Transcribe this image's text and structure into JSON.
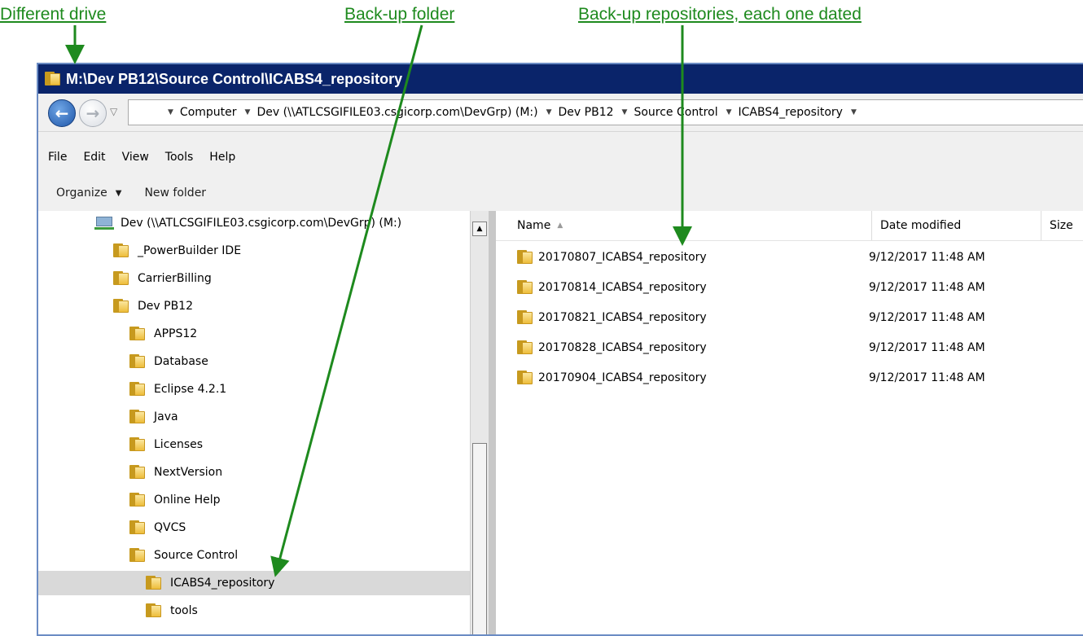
{
  "annotations": {
    "drive": "Different drive",
    "folder": "Back-up folder",
    "repos": "Back-up repositories, each one dated"
  },
  "window": {
    "title": "M:\\Dev PB12\\Source Control\\ICABS4_repository"
  },
  "address": {
    "crumbs": [
      "Computer",
      "Dev (\\\\ATLCSGIFILE03.csgicorp.com\\DevGrp) (M:)",
      "Dev PB12",
      "Source Control",
      "ICABS4_repository"
    ]
  },
  "menu": [
    "File",
    "Edit",
    "View",
    "Tools",
    "Help"
  ],
  "toolbar": {
    "organize": "Organize",
    "new_folder": "New folder"
  },
  "tree": {
    "items": [
      {
        "label": "Dev (\\\\ATLCSGIFILE03.csgicorp.com\\DevGrp) (M:)",
        "icon": "network-drive-icon",
        "selected": false
      },
      {
        "label": "_PowerBuilder IDE",
        "icon": "folder-icon",
        "selected": false
      },
      {
        "label": "CarrierBilling",
        "icon": "folder-icon",
        "selected": false
      },
      {
        "label": "Dev PB12",
        "icon": "folder-icon",
        "selected": false
      },
      {
        "label": "APPS12",
        "icon": "folder-icon",
        "selected": false
      },
      {
        "label": "Database",
        "icon": "folder-icon",
        "selected": false
      },
      {
        "label": "Eclipse 4.2.1",
        "icon": "folder-icon",
        "selected": false
      },
      {
        "label": "Java",
        "icon": "folder-icon",
        "selected": false
      },
      {
        "label": "Licenses",
        "icon": "folder-icon",
        "selected": false
      },
      {
        "label": "NextVersion",
        "icon": "folder-icon",
        "selected": false
      },
      {
        "label": "Online Help",
        "icon": "folder-icon",
        "selected": false
      },
      {
        "label": "QVCS",
        "icon": "folder-icon",
        "selected": false
      },
      {
        "label": "Source Control",
        "icon": "folder-icon",
        "selected": false
      },
      {
        "label": "ICABS4_repository",
        "icon": "folder-icon",
        "selected": true
      },
      {
        "label": "tools",
        "icon": "folder-icon",
        "selected": false
      }
    ]
  },
  "files": {
    "columns": [
      "Name",
      "Date modified",
      "Size"
    ],
    "rows": [
      {
        "name": "20170807_ICABS4_repository",
        "date": "9/12/2017 11:48 AM"
      },
      {
        "name": "20170814_ICABS4_repository",
        "date": "9/12/2017 11:48 AM"
      },
      {
        "name": "20170821_ICABS4_repository",
        "date": "9/12/2017 11:48 AM"
      },
      {
        "name": "20170828_ICABS4_repository",
        "date": "9/12/2017 11:48 AM"
      },
      {
        "name": "20170904_ICABS4_repository",
        "date": "9/12/2017 11:48 AM"
      }
    ]
  },
  "colors": {
    "annotation": "#1e8a1e",
    "titlebar": "#0a246a",
    "selection": "#d9d9d9"
  }
}
